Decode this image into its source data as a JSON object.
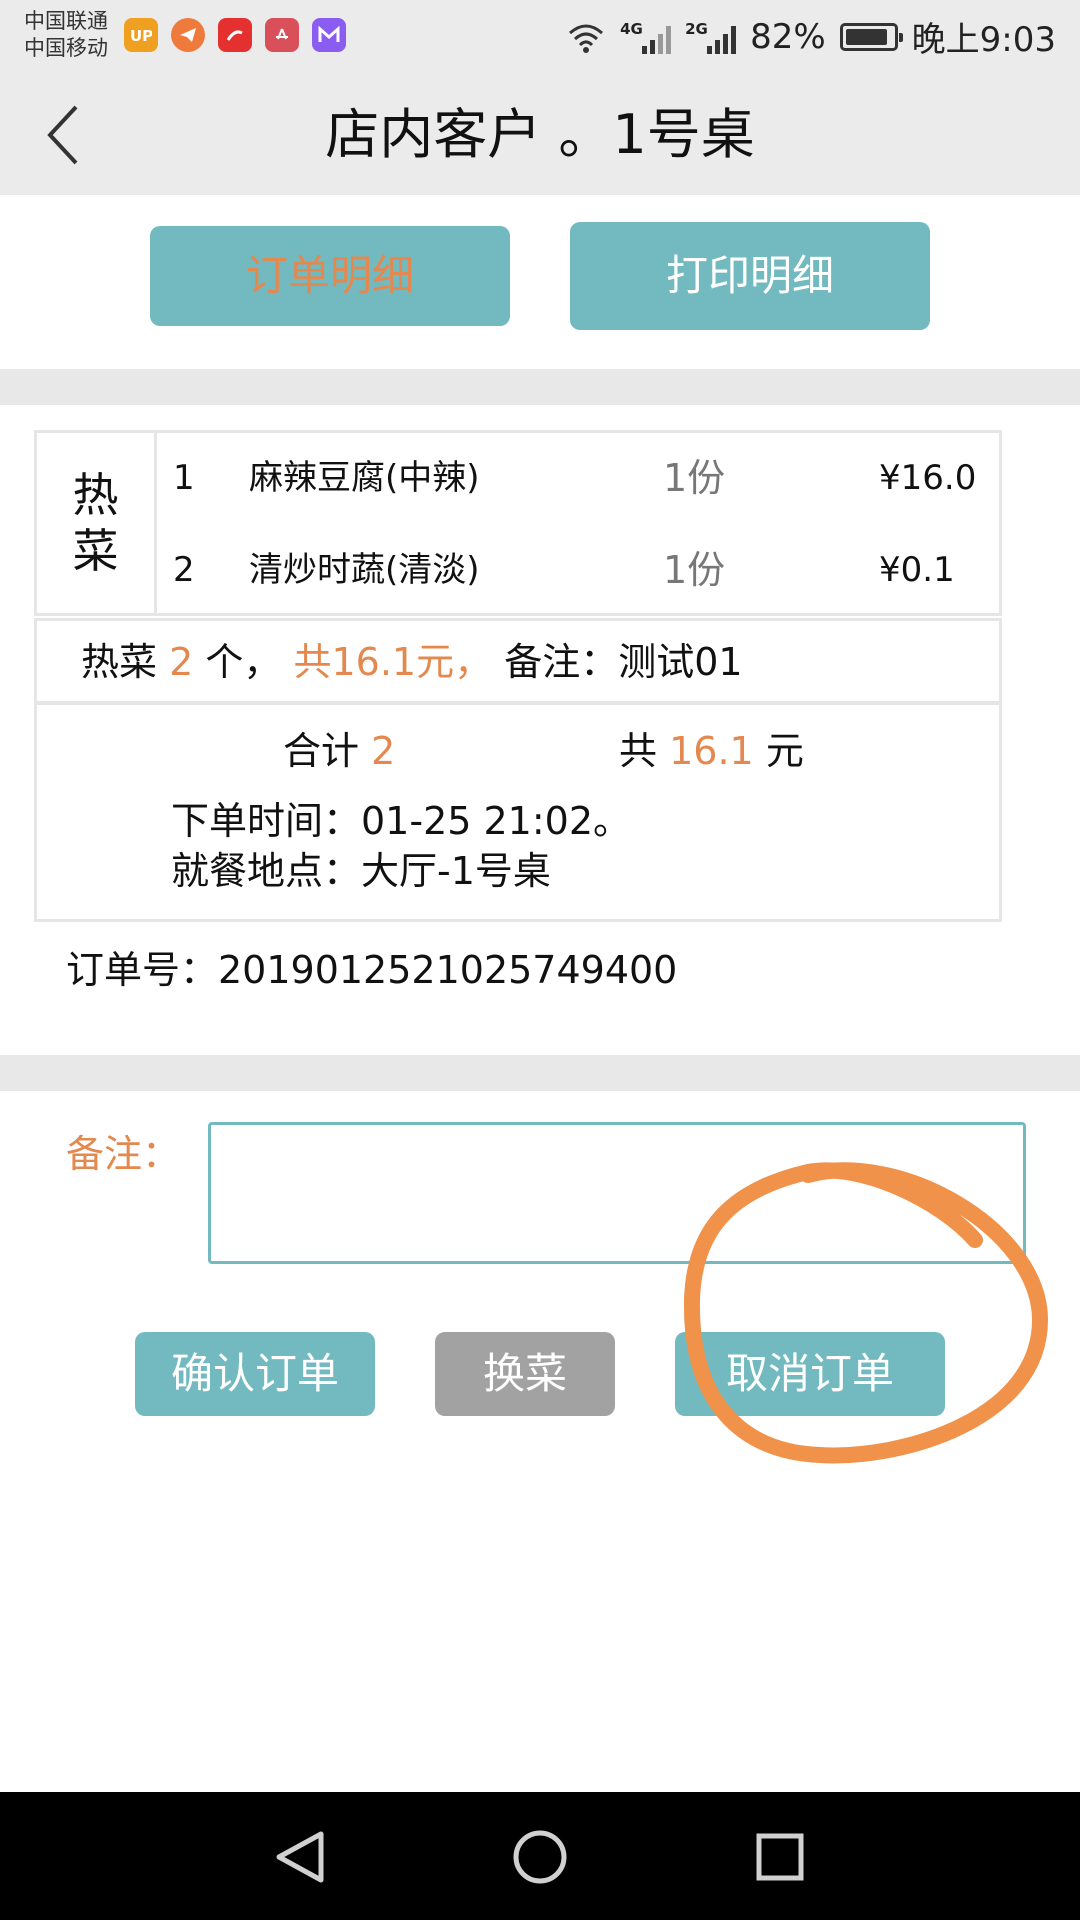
{
  "status_bar": {
    "carrier_1": "中国联通",
    "carrier_2": "中国移动",
    "signal_1_tag": "4G",
    "signal_2_tag": "2G",
    "battery": "82%",
    "time": "晚上9:03",
    "app_icons": [
      "up-app-icon",
      "telegram-icon",
      "red-app-icon",
      "huawei-app-icon",
      "m-app-icon"
    ]
  },
  "header": {
    "title": "店内客户 。1号桌"
  },
  "tabs": {
    "order_detail": "订单明细",
    "print_detail": "打印明细"
  },
  "order": {
    "category": "热菜",
    "items": [
      {
        "no": "1",
        "name": "麻辣豆腐(中辣)",
        "qty": "1份",
        "price": "¥16.0"
      },
      {
        "no": "2",
        "name": "清炒时蔬(清淡)",
        "qty": "1份",
        "price": "¥0.1"
      }
    ],
    "summary": {
      "category": "热菜",
      "count": "2",
      "count_unit": "个，",
      "total_text": "共16.1元，",
      "remark_prefix": "备注：",
      "remark": "测试01"
    },
    "totals": {
      "sum_label": "合计",
      "sum_value": "2",
      "total_label": "共",
      "total_value": "16.1",
      "total_unit": "元"
    },
    "order_time": "下单时间：01-25 21:02。",
    "location": "就餐地点：大厅-1号桌",
    "order_number": "订单号：20190125210257494​00"
  },
  "remark": {
    "label": "备注：",
    "value": ""
  },
  "actions": {
    "confirm": "确认订单",
    "swap": "换菜",
    "cancel": "取消订单"
  },
  "colors": {
    "accent": "#72babf",
    "highlight": "#e3894f",
    "disabled": "#a2a2a2"
  }
}
